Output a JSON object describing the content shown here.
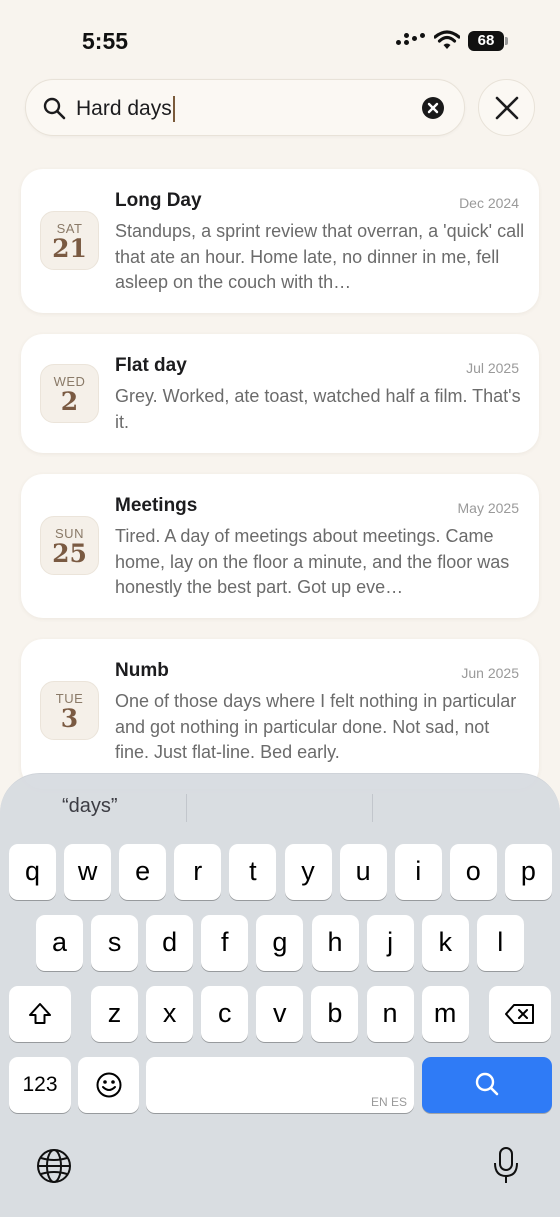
{
  "status_bar": {
    "time": "5:55",
    "battery": "68"
  },
  "search": {
    "query": "Hard days",
    "clear_icon": "clear-circle-icon",
    "close_icon": "close-icon"
  },
  "entries": [
    {
      "weekday": "SAT",
      "day": "21",
      "title": "Long Day",
      "date": "Dec 2024",
      "body": "Standups, a sprint review that overran, a 'quick' call that ate an hour. Home late, no dinner in me, fell asleep on the couch with th…"
    },
    {
      "weekday": "WED",
      "day": "2",
      "title": "Flat day",
      "date": "Jul 2025",
      "body": "Grey. Worked, ate toast, watched half a film. That's it."
    },
    {
      "weekday": "SUN",
      "day": "25",
      "title": "Meetings",
      "date": "May 2025",
      "body": "Tired. A day of meetings about meetings. Came home, lay on the floor a minute, and the floor was honestly the best part. Got up eve…"
    },
    {
      "weekday": "TUE",
      "day": "3",
      "title": "Numb",
      "date": "Jun 2025",
      "body": "One of those days where I felt nothing in particular and got nothing in particular done. Not sad, not fine. Just flat-line. Bed early."
    }
  ],
  "keyboard": {
    "suggestion": "“days”",
    "row1": [
      "q",
      "w",
      "e",
      "r",
      "t",
      "y",
      "u",
      "i",
      "o",
      "p"
    ],
    "row2": [
      "a",
      "s",
      "d",
      "f",
      "g",
      "h",
      "j",
      "k",
      "l"
    ],
    "row3": [
      "z",
      "x",
      "c",
      "v",
      "b",
      "n",
      "m"
    ],
    "numbers_key": "123",
    "language": "EN ES"
  },
  "colors": {
    "background": "#f8f4ee",
    "accent": "#2f7bf6",
    "badge_number": "#7a5a42"
  }
}
